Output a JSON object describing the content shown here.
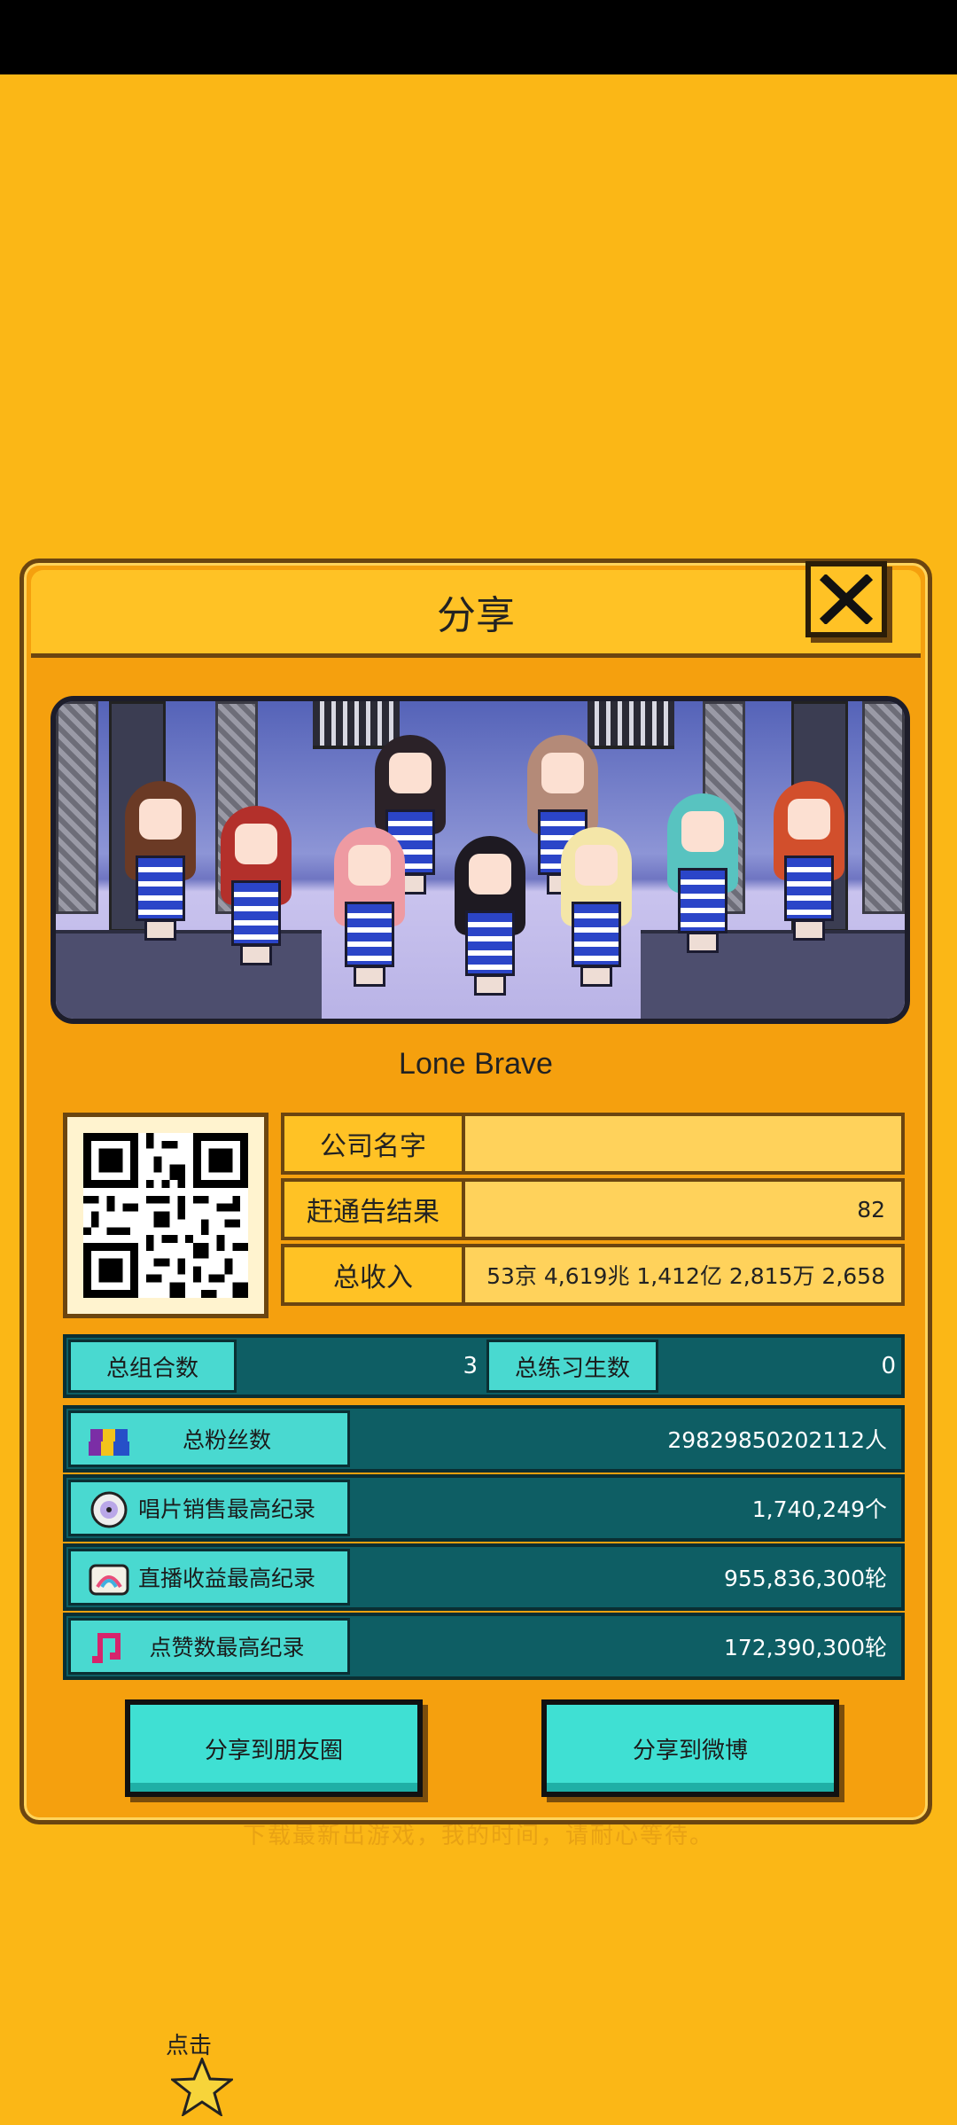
{
  "background_text": "下载最新出游戏，我的时间，请耐心等待。",
  "dialog": {
    "title": "分享",
    "close_icon": "close-x-icon"
  },
  "group_name": "Lone Brave",
  "company": {
    "rows": [
      {
        "label": "公司名字",
        "value": ""
      },
      {
        "label": "赶通告结果",
        "value": "82"
      },
      {
        "label": "总收入",
        "value": "53京 4,619兆 1,412亿 2,815万 2,658"
      }
    ]
  },
  "counts": {
    "groups_label": "总组合数",
    "groups_value": "3",
    "trainees_label": "总练习生数",
    "trainees_value": "0"
  },
  "stats": [
    {
      "label": "总粉丝数",
      "value": "29829850202112人",
      "icon": "fans-icon"
    },
    {
      "label": "唱片销售最高纪录",
      "value": "1,740,249个",
      "icon": "disc-icon"
    },
    {
      "label": "直播收益最高纪录",
      "value": "955,836,300轮",
      "icon": "live-icon"
    },
    {
      "label": "点赞数最高纪录",
      "value": "172,390,300轮",
      "icon": "music-note-icon"
    }
  ],
  "hint": {
    "text": "点击",
    "icon": "star-icon"
  },
  "buttons": {
    "moments": "分享到朋友圈",
    "weibo": "分享到微博"
  },
  "colors": {
    "background": "#FBB716",
    "panel": "#F5A00E",
    "teal": "#49D9D0",
    "dark_teal": "#0E5E64"
  }
}
